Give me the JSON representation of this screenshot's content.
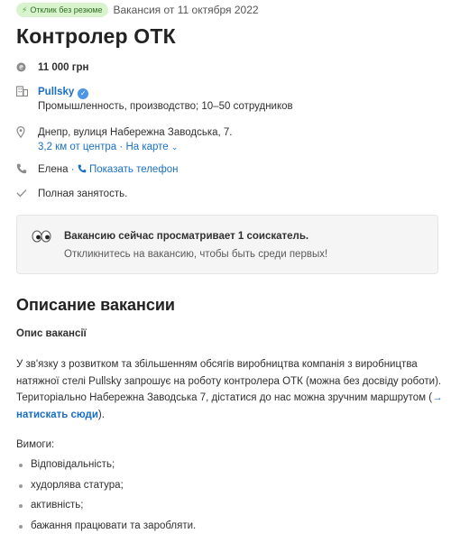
{
  "badge": {
    "label": "Отклик без резюме"
  },
  "posted": "Вакансия от 11 октября 2022",
  "job_title": "Контролер ОТК",
  "salary": "11 000 грн",
  "company": {
    "name": "Pullsky",
    "details": "Промышленность, производство; 10–50 сотрудников"
  },
  "address": {
    "line": "Днепр, вулиця Набережна Заводська, 7.",
    "distance": "3,2 км от центра",
    "separator": "·",
    "map_link": "На карте"
  },
  "contact": {
    "name": "Елена",
    "separator": "·",
    "phone_link": "Показать телефон"
  },
  "employment": "Полная занятость.",
  "notice": {
    "line1": "Вакансию сейчас просматривает 1 соискатель.",
    "line2": "Откликнитесь на вакансию, чтобы быть среди первых!"
  },
  "description": {
    "heading": "Описание вакансии",
    "subheading": "Опис вакансії",
    "paragraph_text": "У зв'язку з розвитком та збільшенням обсягів виробництва компанія з виробництва натяжної стелі Pullsky запрошує на роботу контролера ОТК (можна без досвіду роботи). Територіально Набережна Заводська 7, дістатися до нас можна зручним маршрутом (",
    "paragraph_link": "→ натискать сюди",
    "paragraph_end": ").",
    "requirements_label": "Вимоги:",
    "requirements": [
      "Відповідальність;",
      "худорлява статура;",
      "активність;",
      "бажання працювати та заробляти."
    ]
  },
  "colors": {
    "link": "#1a6fc4",
    "badge_bg": "#d9f3cf",
    "badge_text": "#2f6e22",
    "verified": "#4b96e6"
  },
  "icons": {
    "salary": "coin-icon",
    "company": "building-icon",
    "address": "location-pin-icon",
    "contact": "phone-icon",
    "employment": "checkmark-icon",
    "notice": "eyes-icon"
  }
}
